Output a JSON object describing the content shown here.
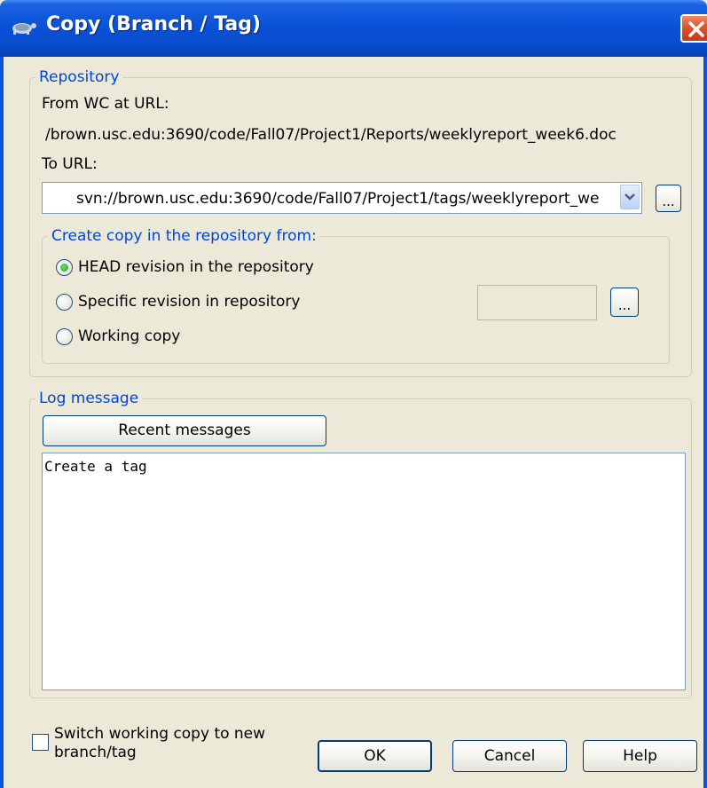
{
  "window": {
    "title": "Copy (Branch / Tag)",
    "icon": "tortoise-icon",
    "close_icon": "close-icon"
  },
  "repository": {
    "legend": "Repository",
    "from_label": "From WC at URL:",
    "from_url": "/brown.usc.edu:3690/code/Fall07/Project1/Reports/weeklyreport_week6.doc",
    "to_label": "To URL:",
    "to_url": "svn://brown.usc.edu:3690/code/Fall07/Project1/tags/weeklyreport_we",
    "browse_label": "..."
  },
  "copy_from": {
    "legend": "Create copy in the repository from:",
    "options": [
      {
        "label": "HEAD revision in the repository",
        "checked": true
      },
      {
        "label": "Specific revision in repository",
        "checked": false
      },
      {
        "label": "Working copy",
        "checked": false
      }
    ],
    "revision_value": "",
    "revision_browse_label": "..."
  },
  "log": {
    "legend": "Log message",
    "recent_label": "Recent messages",
    "message": "Create a tag"
  },
  "footer": {
    "switch_label_line1": "Switch working copy to new",
    "switch_label_line2": "branch/tag",
    "switch_checked": false,
    "ok_label": "OK",
    "cancel_label": "Cancel",
    "help_label": "Help"
  },
  "colors": {
    "title_bar": "#0a52d8",
    "legend_text": "#0046d5",
    "dialog_bg": "#ece9d8"
  }
}
